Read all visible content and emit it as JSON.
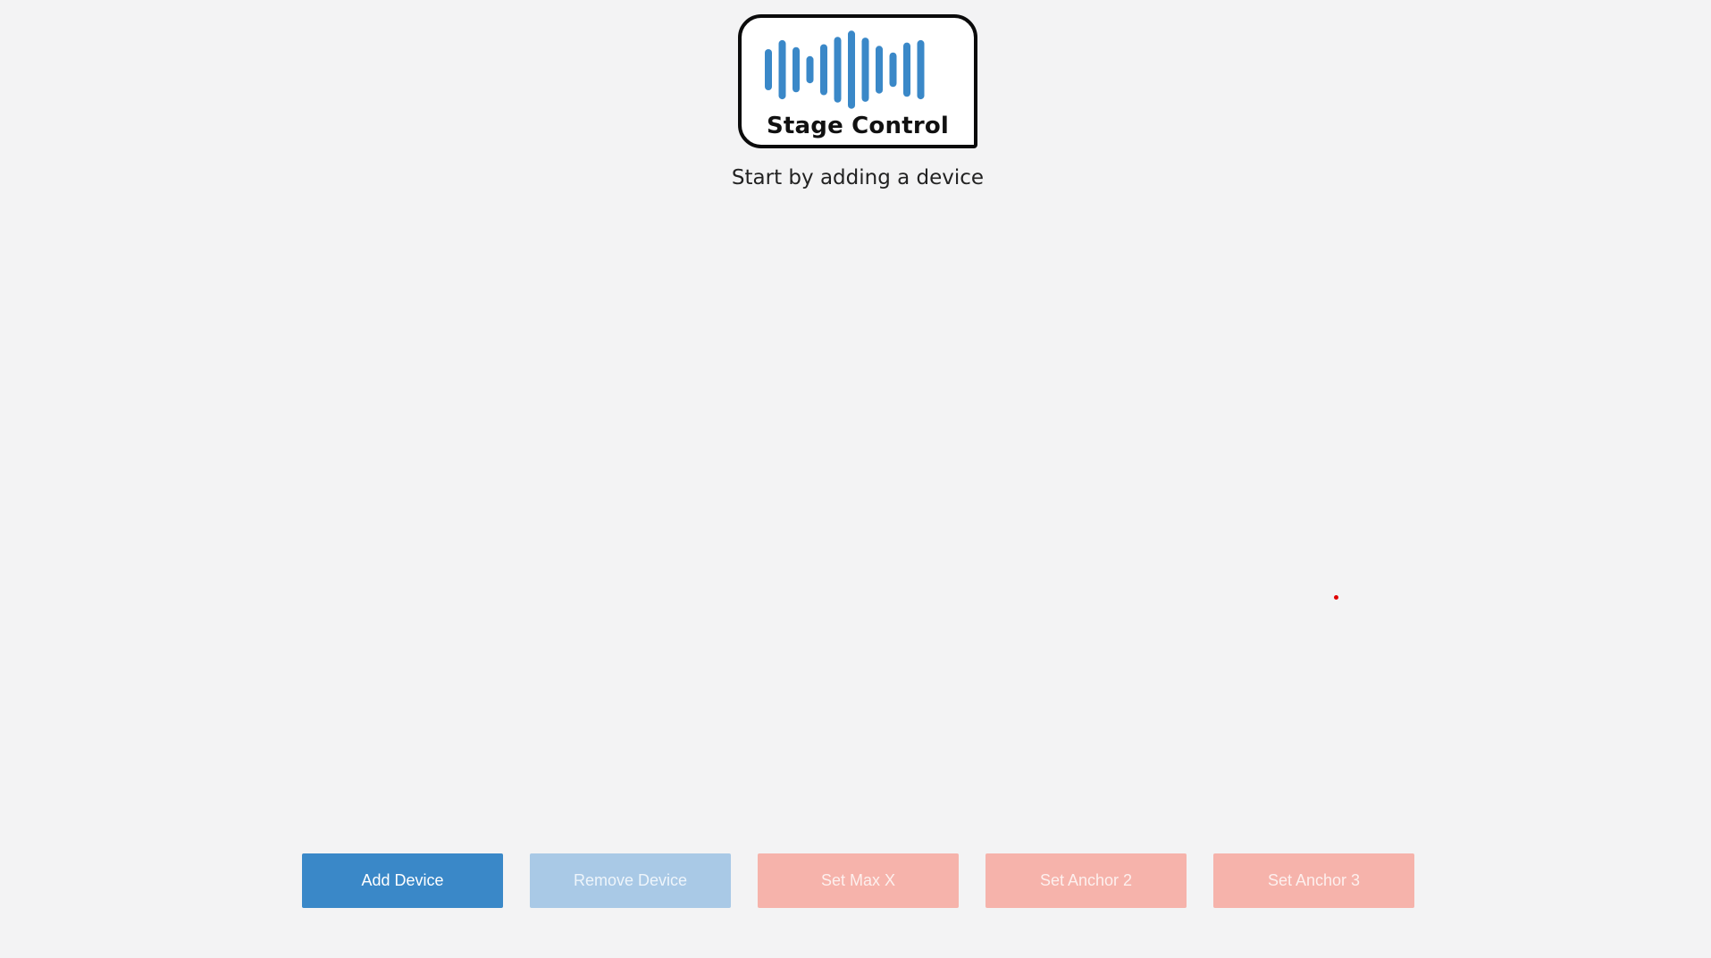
{
  "logo": {
    "text": "Stage Control",
    "bar_color": "#3a88c8",
    "bar_levels": [
      0.5,
      0.72,
      0.55,
      0.33,
      0.62,
      0.8,
      0.95,
      0.78,
      0.58,
      0.42,
      0.66,
      0.72
    ]
  },
  "header": {
    "subtitle": "Start by adding a device"
  },
  "stage": {
    "marker_color": "#e00000"
  },
  "toolbar": {
    "add_label": "Add Device",
    "remove_label": "Remove Device",
    "max_x_label": "Set Max X",
    "anchor2_label": "Set Anchor 2",
    "anchor3_label": "Set Anchor 3"
  },
  "colors": {
    "background": "#f3f3f4",
    "primary": "#3a88c8",
    "primary_disabled": "#a9c9e6",
    "danger_disabled": "#f6b3ab"
  }
}
